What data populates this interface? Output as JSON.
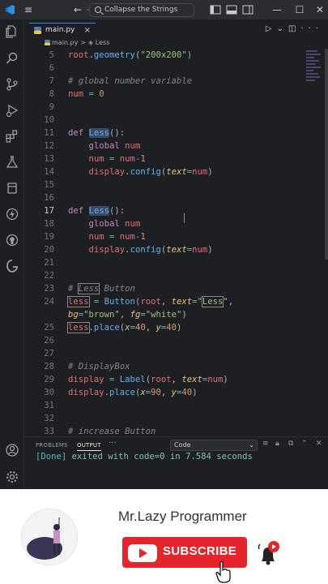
{
  "titlebar": {
    "search_text": "Collapse the Strings",
    "icons": [
      "vscode-logo",
      "menu-icon",
      "back-arrow-icon",
      "forward-arrow-icon",
      "search-icon",
      "layout-sidebar-icon",
      "layout-panel-icon",
      "layout-split-icon",
      "minimize-icon",
      "maximize-icon",
      "close-icon"
    ]
  },
  "activity_bar": {
    "icons": [
      "explorer-icon",
      "search-icon",
      "source-control-icon",
      "run-debug-icon",
      "extensions-icon",
      "testing-icon",
      "remote-icon",
      "github-icon",
      "live-share-icon",
      "account-icon",
      "settings-gear-icon"
    ]
  },
  "tab": {
    "label": "main.py",
    "close": "×"
  },
  "breadcrumb": {
    "file": "main.py",
    "symbol": "Less",
    "separator": ">"
  },
  "editor": {
    "line_numbers": [
      "5",
      "6",
      "7",
      "8",
      "9",
      "10",
      "11",
      "12",
      "13",
      "14",
      "15",
      "16",
      "17",
      "18",
      "19",
      "20",
      "21",
      "22",
      "23",
      "24",
      "",
      "25",
      "26",
      "27",
      "28",
      "29",
      "30",
      "31",
      "32",
      "33"
    ],
    "active_line": "17"
  },
  "panel": {
    "tabs": [
      "PROBLEMS",
      "OUTPUT"
    ],
    "more": "···",
    "output_channel": "Code",
    "output_done": "[Done]",
    "output_text": " exited with code=0 in 7.584 seconds"
  },
  "promo": {
    "channel_name": "Mr.Lazy Programmer",
    "subscribe_label": "SUBSCRIBE"
  },
  "colors": {
    "editor_bg": "#1e1f22",
    "subscribe_red": "#e5242b",
    "keyword": "#c586c0",
    "string": "#98c379",
    "variable": "#e06c75"
  }
}
